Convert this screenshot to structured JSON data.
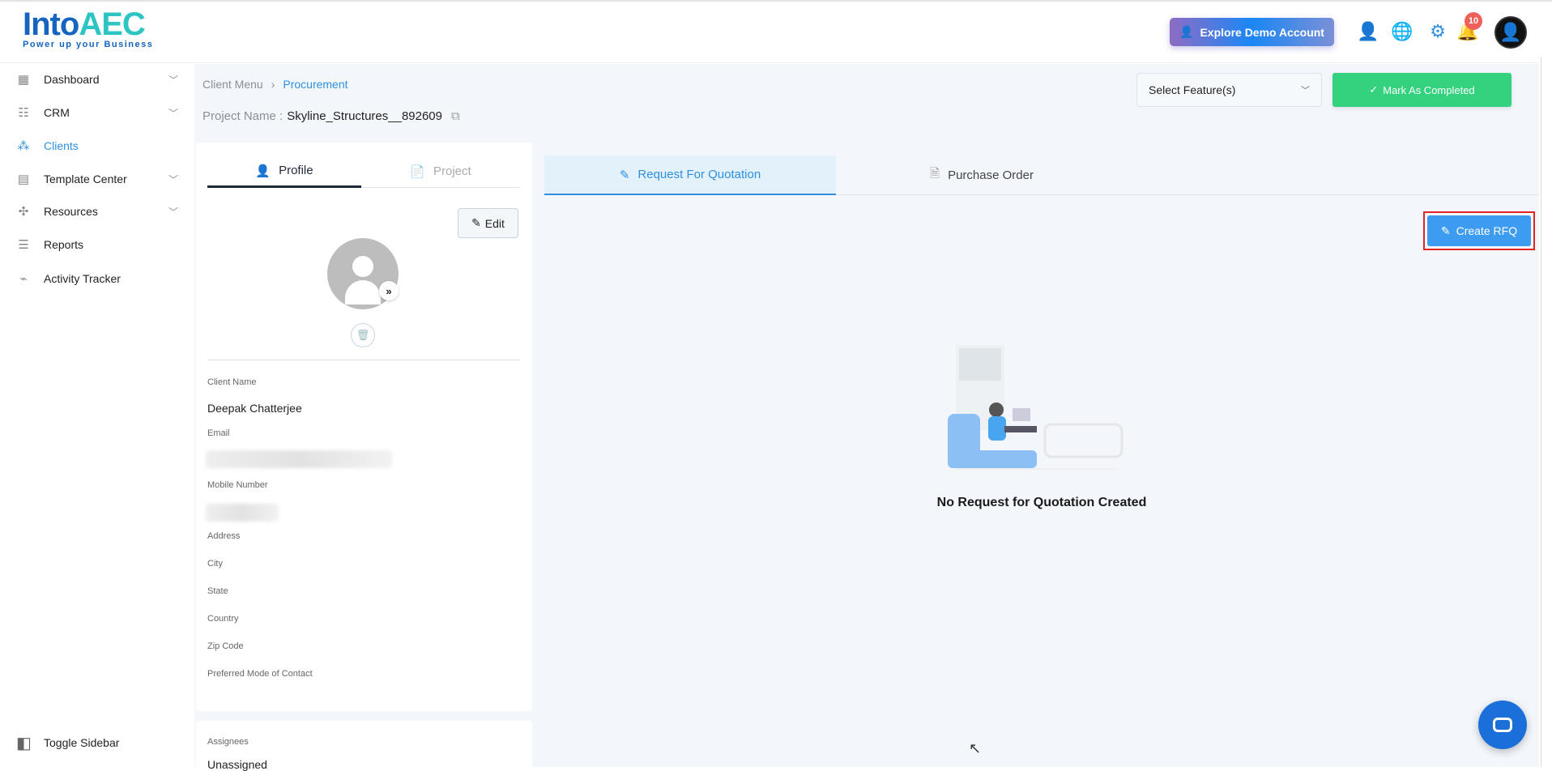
{
  "header": {
    "logo_text": "IntoAEC",
    "logo_tagline": "Power up your Business",
    "demo_button": "Explore Demo Account",
    "notification_count": "10"
  },
  "sidebar": {
    "items": [
      {
        "label": "Dashboard",
        "icon": "dashboard-icon",
        "has_chevron": true
      },
      {
        "label": "CRM",
        "icon": "crm-icon",
        "has_chevron": true
      },
      {
        "label": "Clients",
        "icon": "clients-icon",
        "active": true
      },
      {
        "label": "Template Center",
        "icon": "template-icon",
        "has_chevron": true
      },
      {
        "label": "Resources",
        "icon": "resources-icon",
        "has_chevron": true
      },
      {
        "label": "Reports",
        "icon": "reports-icon"
      },
      {
        "label": "Activity Tracker",
        "icon": "activity-icon"
      }
    ],
    "toggle_label": "Toggle Sidebar"
  },
  "breadcrumb": {
    "parent": "Client Menu",
    "current": "Procurement"
  },
  "project": {
    "label": "Project Name :",
    "name": "Skyline_Structures__892609"
  },
  "toolbar": {
    "select_placeholder": "Select Feature(s)",
    "mark_completed": "Mark As Completed"
  },
  "profile_panel": {
    "tabs": [
      "Profile",
      "Project"
    ],
    "edit_label": "Edit",
    "fields": {
      "client_name_label": "Client Name",
      "client_name": "Deepak Chatterjee",
      "email_label": "Email",
      "mobile_label": "Mobile Number",
      "address_label": "Address",
      "city_label": "City",
      "state_label": "State",
      "country_label": "Country",
      "zip_label": "Zip Code",
      "contact_mode_label": "Preferred Mode of Contact"
    },
    "assignees_label": "Assignees",
    "assignees_value": "Unassigned"
  },
  "procurement": {
    "tabs": [
      "Request For Quotation",
      "Purchase Order"
    ],
    "create_button": "Create RFQ",
    "empty_message": "No Request for Quotation Created"
  },
  "colors": {
    "accent": "#2f8fe0",
    "success": "#34d17e",
    "badge": "#f0605a"
  }
}
